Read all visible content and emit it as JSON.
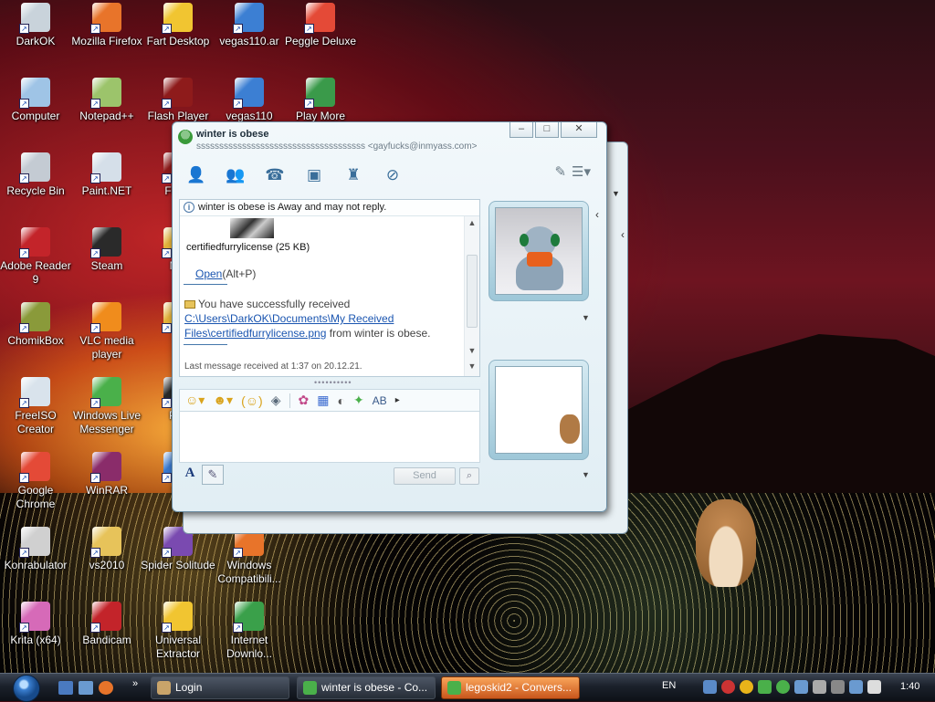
{
  "desktop": {
    "icons": [
      {
        "label": "DarkOK",
        "color": "#c9d3db"
      },
      {
        "label": "Mozilla Firefox",
        "color": "#e8742a"
      },
      {
        "label": "Fart Desktop",
        "color": "#f1c531"
      },
      {
        "label": "vegas110.ar",
        "color": "#3c7fd3"
      },
      {
        "label": "Peggle Deluxe",
        "color": "#e44a37"
      },
      {
        "label": "Computer",
        "color": "#9fc4e6"
      },
      {
        "label": "Notepad++",
        "color": "#9cc46b"
      },
      {
        "label": "Flash Player",
        "color": "#8e1b1b"
      },
      {
        "label": "vegas110",
        "color": "#3c7fd3"
      },
      {
        "label": "Play More",
        "color": "#3a9a4a"
      },
      {
        "label": "Recycle Bin",
        "color": "#c4cbd3"
      },
      {
        "label": "Paint.NET",
        "color": "#d5dfe9"
      },
      {
        "label": "Flash",
        "color": "#8e1b1b"
      },
      {
        "label": "Adobe Reader 9",
        "color": "#c3242a"
      },
      {
        "label": "Steam",
        "color": "#2a2a2a"
      },
      {
        "label": "Mic",
        "color": "#e4b23a"
      },
      {
        "label": "ChomikBox",
        "color": "#8a9a3a"
      },
      {
        "label": "VLC media player",
        "color": "#f08c1c"
      },
      {
        "label": "P",
        "color": "#e4b23a"
      },
      {
        "label": "FreeISO Creator",
        "color": "#d9e3ec"
      },
      {
        "label": "Windows Live Messenger",
        "color": "#4ab04a"
      },
      {
        "label": "PIC",
        "color": "#2a2a2a"
      },
      {
        "label": "Google Chrome",
        "color": "#e44a37"
      },
      {
        "label": "WinRAR",
        "color": "#8a2c6a"
      },
      {
        "label": "So",
        "color": "#3a7ad0"
      },
      {
        "label": "Konrabulator",
        "color": "#d0d0d0"
      },
      {
        "label": "vs2010",
        "color": "#e7c35a"
      },
      {
        "label": "Spider Solitude",
        "color": "#7a4ab0"
      },
      {
        "label": "Windows Compatibili...",
        "color": "#e8742a"
      },
      {
        "label": "Krita (x64)",
        "color": "#d66ab8"
      },
      {
        "label": "Bandicam",
        "color": "#c3242a"
      },
      {
        "label": "Universal Extractor",
        "color": "#f1c531"
      },
      {
        "label": "Internet Downlo...",
        "color": "#3aa04a"
      }
    ]
  },
  "messenger": {
    "contact_name": "winter is obese",
    "personal_message": "sssssssssssssssssssssssssssssssssssss <gayfucks@inmyass.com>",
    "title_buttons": {
      "minimize": "–",
      "maximize": "□",
      "close": "✕"
    },
    "status_notice": "winter is obese is Away and may not reply.",
    "file_name": "certifiedfurrylicense (25 KB)",
    "open_label": "Open",
    "open_shortcut": "(Alt+P)",
    "received_prefix": "You have successfully received ",
    "received_path": "C:\\Users\\DarkOK\\Documents\\My Received Files\\certifiedfurrylicense.png",
    "received_suffix": " from winter is obese.",
    "last_message": "Last message received at 1:37 on 20.12.21.",
    "splitter": "••••••••••",
    "send_label": "Send",
    "font_label": "A"
  },
  "taskbar": {
    "more": "»",
    "tasks": [
      {
        "label": "Login",
        "color": "#c9a46a",
        "active": false
      },
      {
        "label": "winter is obese - Co...",
        "color": "#4ab04a",
        "active": false
      },
      {
        "label": "legoskid2 - Convers...",
        "color": "#4ab04a",
        "active": true
      }
    ],
    "language": "EN",
    "clock": "1:40"
  }
}
